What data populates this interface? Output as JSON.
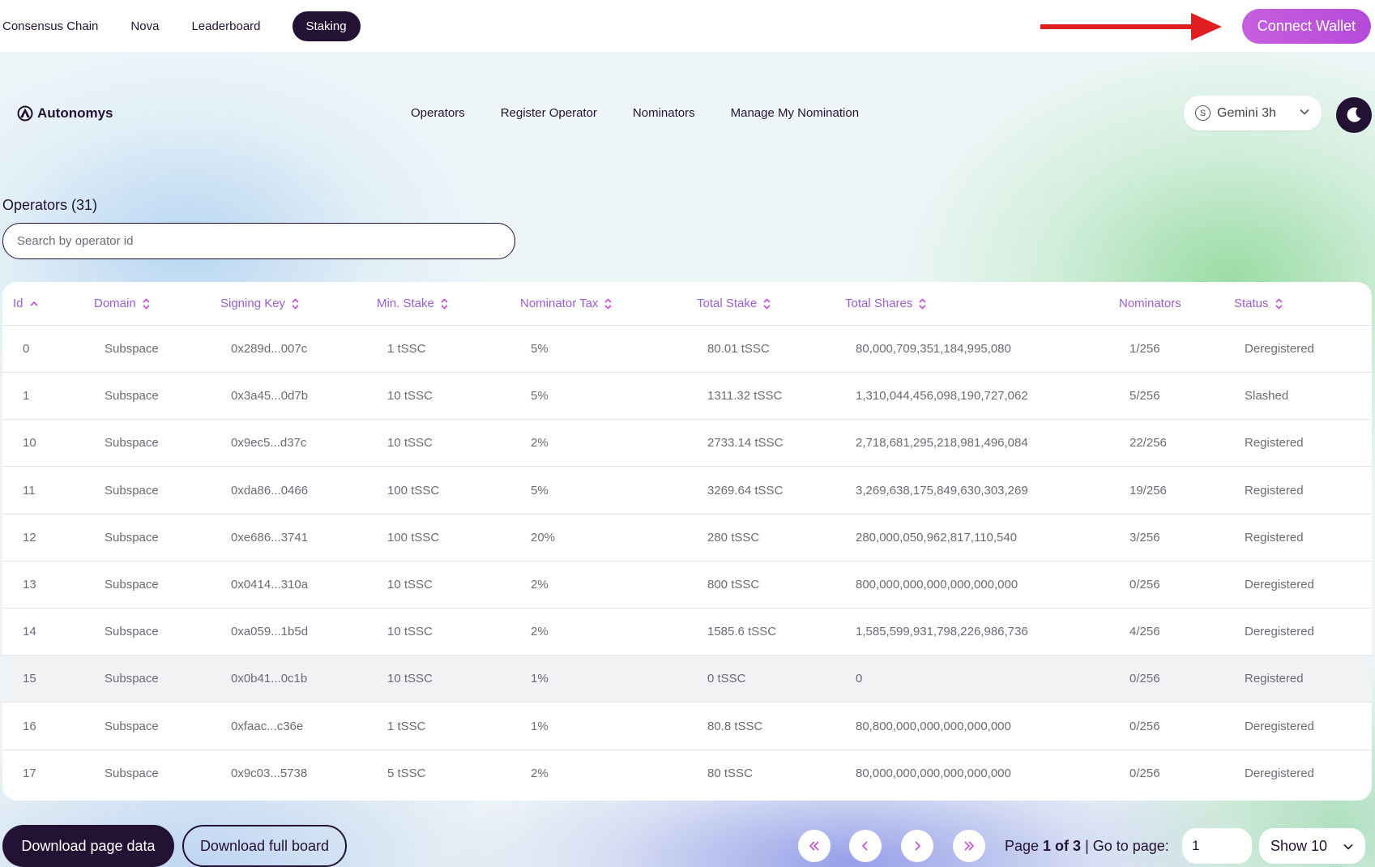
{
  "topnav": {
    "items": [
      {
        "label": "Consensus Chain",
        "active": false
      },
      {
        "label": "Nova",
        "active": false
      },
      {
        "label": "Leaderboard",
        "active": false
      },
      {
        "label": "Staking",
        "active": true
      }
    ],
    "connect_label": "Connect Wallet"
  },
  "brand": {
    "name": "Autonomys"
  },
  "subnav": {
    "items": [
      "Operators",
      "Register Operator",
      "Nominators",
      "Manage My Nomination"
    ]
  },
  "network": {
    "icon_letter": "S",
    "label": "Gemini 3h"
  },
  "operators": {
    "title": "Operators (31)",
    "search_placeholder": "Search by operator id"
  },
  "table": {
    "columns": [
      "Id",
      "Domain",
      "Signing Key",
      "Min. Stake",
      "Nominator Tax",
      "Total Stake",
      "Total Shares",
      "Nominators",
      "Status"
    ],
    "rows": [
      [
        "0",
        "Subspace",
        "0x289d...007c",
        "1 tSSC",
        "5%",
        "80.01 tSSC",
        "80,000,709,351,184,995,080",
        "1/256",
        "Deregistered"
      ],
      [
        "1",
        "Subspace",
        "0x3a45...0d7b",
        "10 tSSC",
        "5%",
        "1311.32 tSSC",
        "1,310,044,456,098,190,727,062",
        "5/256",
        "Slashed"
      ],
      [
        "10",
        "Subspace",
        "0x9ec5...d37c",
        "10 tSSC",
        "2%",
        "2733.14 tSSC",
        "2,718,681,295,218,981,496,084",
        "22/256",
        "Registered"
      ],
      [
        "11",
        "Subspace",
        "0xda86...0466",
        "100 tSSC",
        "5%",
        "3269.64 tSSC",
        "3,269,638,175,849,630,303,269",
        "19/256",
        "Registered"
      ],
      [
        "12",
        "Subspace",
        "0xe686...3741",
        "100 tSSC",
        "20%",
        "280 tSSC",
        "280,000,050,962,817,110,540",
        "3/256",
        "Registered"
      ],
      [
        "13",
        "Subspace",
        "0x0414...310a",
        "10 tSSC",
        "2%",
        "800 tSSC",
        "800,000,000,000,000,000,000",
        "0/256",
        "Deregistered"
      ],
      [
        "14",
        "Subspace",
        "0xa059...1b5d",
        "10 tSSC",
        "2%",
        "1585.6 tSSC",
        "1,585,599,931,798,226,986,736",
        "4/256",
        "Deregistered"
      ],
      [
        "15",
        "Subspace",
        "0x0b41...0c1b",
        "10 tSSC",
        "1%",
        "0 tSSC",
        "0",
        "0/256",
        "Registered"
      ],
      [
        "16",
        "Subspace",
        "0xfaac...c36e",
        "1 tSSC",
        "1%",
        "80.8 tSSC",
        "80,800,000,000,000,000,000",
        "0/256",
        "Deregistered"
      ],
      [
        "17",
        "Subspace",
        "0x9c03...5738",
        "5 tSSC",
        "2%",
        "80 tSSC",
        "80,000,000,000,000,000,000",
        "0/256",
        "Deregistered"
      ]
    ]
  },
  "footer": {
    "download_page": "Download page data",
    "download_full": "Download full board",
    "page_prefix": "Page ",
    "page_current": "1 of 3",
    "goto_label": " | Go to page:",
    "goto_value": "1",
    "show_label": "Show 10"
  },
  "colors": {
    "primary_dark": "#241235",
    "accent_purple": "#b44bd8",
    "header_text": "#9a5fcf",
    "annotation_arrow": "#e02020"
  }
}
